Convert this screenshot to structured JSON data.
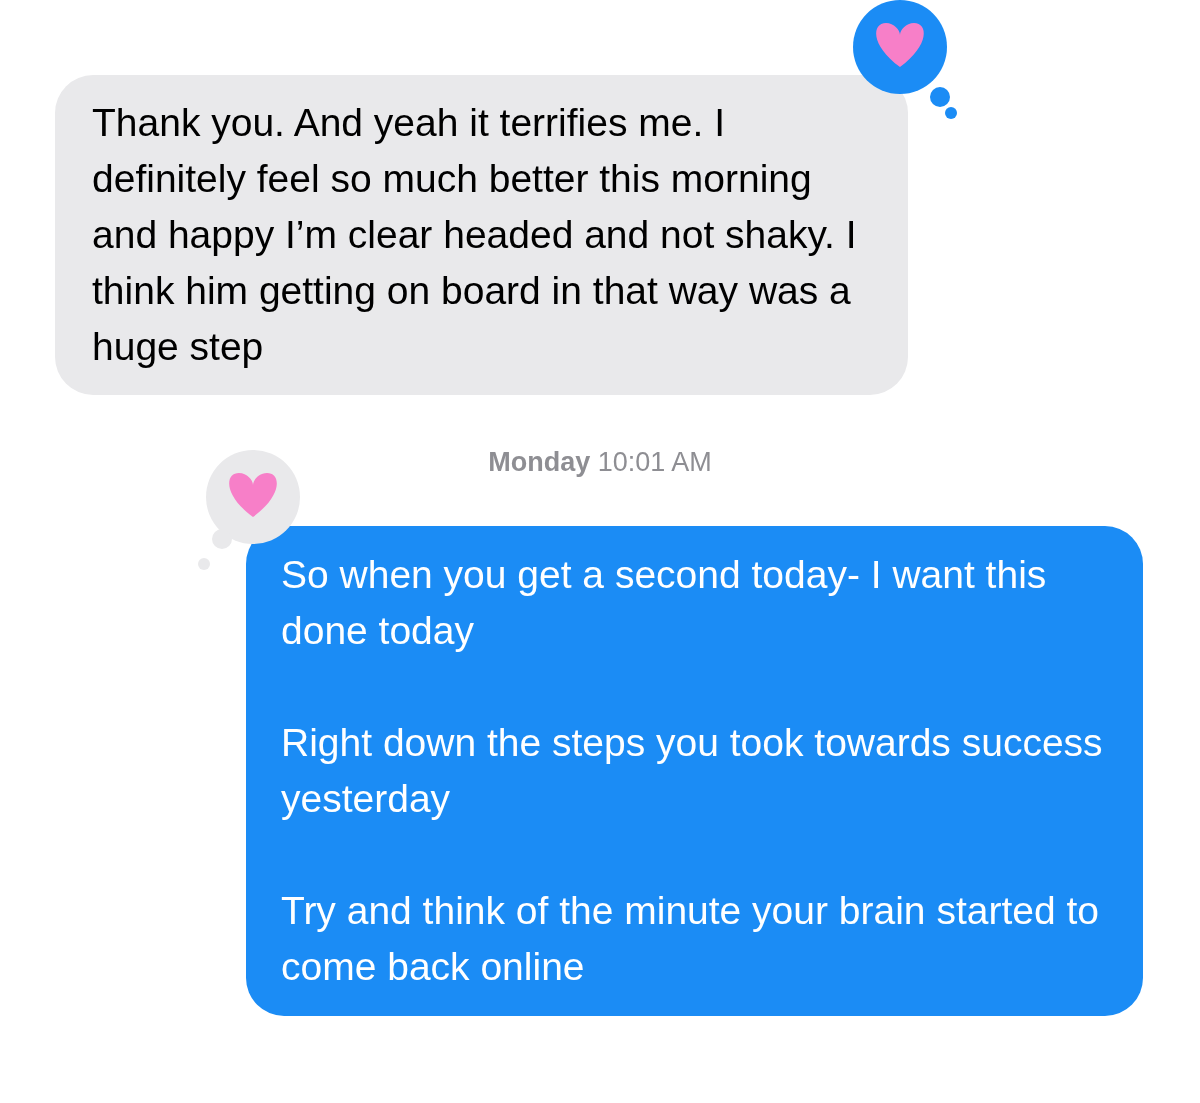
{
  "messages": [
    {
      "kind": "received",
      "paragraphs": [
        "Thank you. And yeah it terrifies me. I definitely feel so much better this morning and happy I’m clear headed and not shaky. I think him getting on board in that way was a huge step"
      ],
      "reaction": {
        "kind": "heart",
        "mine": true
      }
    },
    {
      "kind": "timestamp",
      "day": "Monday",
      "time": "10:01 AM"
    },
    {
      "kind": "sent",
      "paragraphs": [
        "So when you get a second today- I want this done today",
        "Right down the steps you took towards success yesterday",
        "Try and think of the minute your brain started to come back online"
      ],
      "reaction": {
        "kind": "heart",
        "mine": false
      }
    }
  ]
}
